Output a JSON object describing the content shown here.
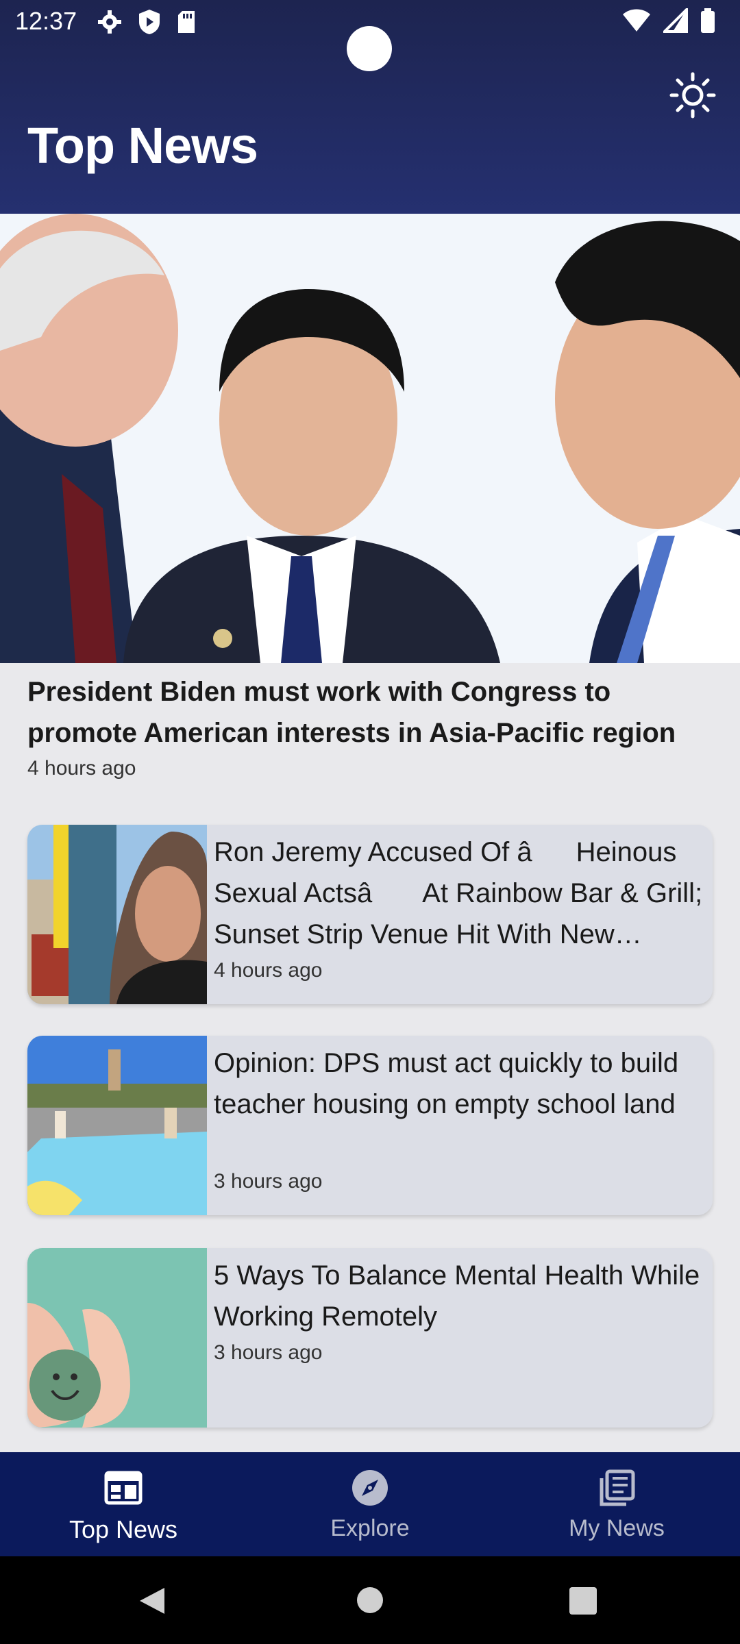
{
  "status_bar": {
    "time": "12:37"
  },
  "header": {
    "title": "Top News"
  },
  "hero": {
    "title": "President Biden must work with Congress to promote American interests in Asia-Pacific region",
    "time": "4 hours ago"
  },
  "articles": [
    {
      "title": "Ron Jeremy Accused Of âHeinous Sexual Actsâ At Rainbow Bar & Grill; Sunset Strip Venue Hit With New Lawsuit",
      "time": "4 hours ago"
    },
    {
      "title": "Opinion: DPS must act quickly to build teacher housing on empty school land",
      "time": "3 hours ago"
    },
    {
      "title": "5 Ways To Balance Mental Health While Working Remotely",
      "time": "3 hours ago"
    }
  ],
  "bottom_nav": [
    {
      "label": "Top News",
      "icon": "newspaper-icon",
      "active": true
    },
    {
      "label": "Explore",
      "icon": "compass-icon",
      "active": false
    },
    {
      "label": "My News",
      "icon": "library-icon",
      "active": false
    }
  ]
}
